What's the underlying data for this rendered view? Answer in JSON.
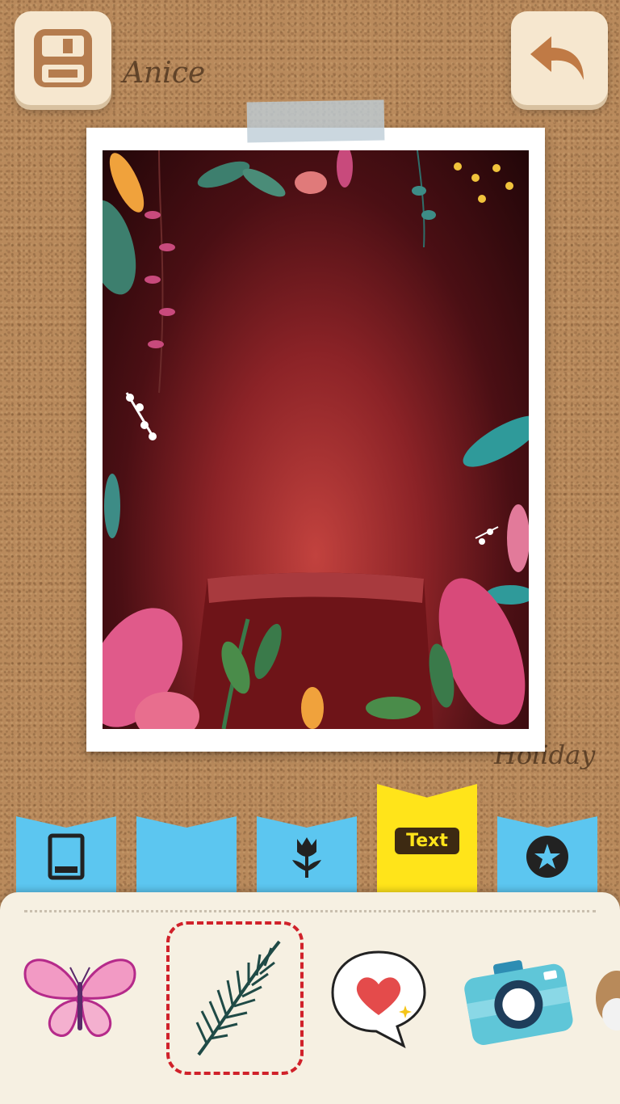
{
  "scribbles": {
    "top": "Anice",
    "bottom": "Holiday"
  },
  "toolbar": {
    "save_icon": "floppy-disk-icon",
    "back_icon": "undo-arrow-icon"
  },
  "tabs": [
    {
      "id": "frame",
      "icon": "photo-frame-icon"
    },
    {
      "id": "blank",
      "icon": ""
    },
    {
      "id": "flower",
      "icon": "tulip-icon"
    },
    {
      "id": "text",
      "label": "Text"
    },
    {
      "id": "badge",
      "icon": "star-badge-icon"
    }
  ],
  "stickers": [
    {
      "name": "butterfly",
      "icon": "butterfly-icon"
    },
    {
      "name": "palm-leaf",
      "icon": "palm-leaf-icon",
      "selected": true
    },
    {
      "name": "heart-bubble",
      "icon": "heart-speech-bubble-icon"
    },
    {
      "name": "camera",
      "icon": "camera-icon"
    }
  ],
  "colors": {
    "tab_blue": "#5cc6f0",
    "tab_yellow": "#ffe41a",
    "selection_red": "#d0212a"
  }
}
